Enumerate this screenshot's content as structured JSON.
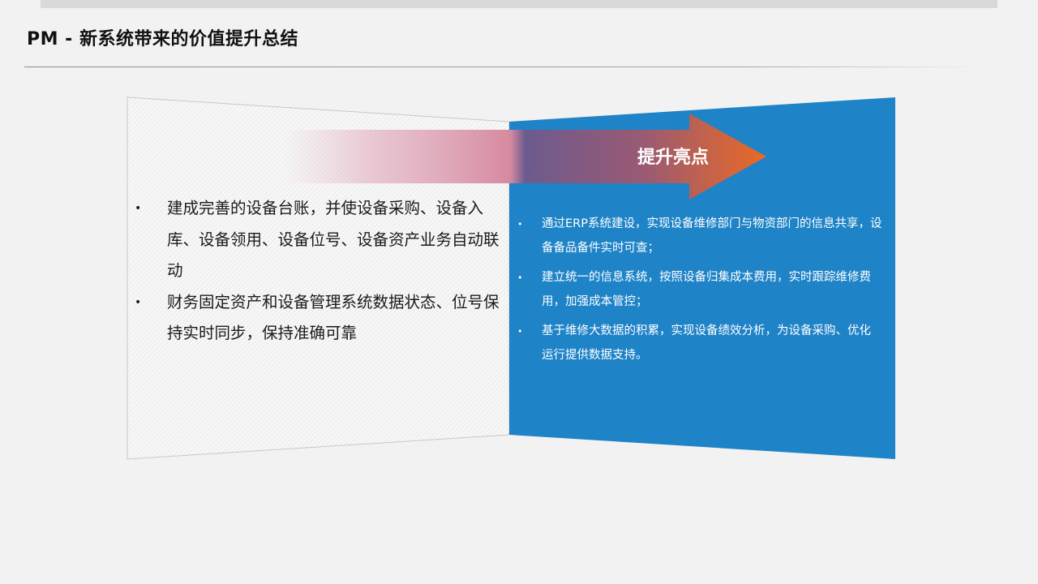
{
  "slide": {
    "title": "PM - 新系统带来的价值提升总结"
  },
  "colors": {
    "background": "#f2f2f2",
    "accent_blue": "#1e83c7",
    "arrow_start": "#d7a0b4",
    "arrow_end": "#e8692a"
  },
  "left_panel": {
    "bullets": [
      "建成完善的设备台账，并使设备采购、设备入库、设备领用、设备位号、设备资产业务自动联动",
      "财务固定资产和设备管理系统数据状态、位号保持实时同步，保持准确可靠"
    ]
  },
  "arrow": {
    "label": "提升亮点"
  },
  "right_panel": {
    "bullets": [
      "通过ERP系统建设，实现设备维修部门与物资部门的信息共享，设备备品备件实时可查；",
      "建立统一的信息系统，按照设备归集成本费用，实时跟踪维修费用，加强成本管控；",
      "基于维修大数据的积累，实现设备绩效分析，为设备采购、优化运行提供数据支持。"
    ]
  },
  "bullet_glyph": "•"
}
